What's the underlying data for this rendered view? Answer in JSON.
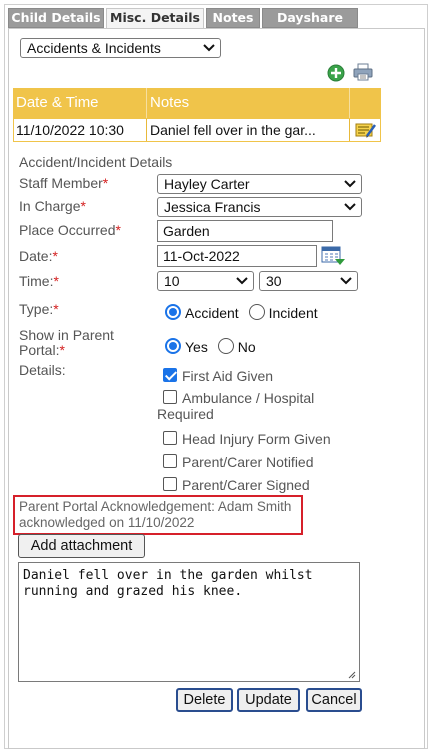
{
  "tabs": [
    {
      "label": "Child Details",
      "active": false
    },
    {
      "label": "Misc. Details",
      "active": true
    },
    {
      "label": "Notes",
      "active": false
    },
    {
      "label": "Dayshare",
      "active": false
    }
  ],
  "category_select": {
    "value": "Accidents & Incidents"
  },
  "toolbar": {
    "add_icon": "add-circle-icon",
    "print_icon": "printer-icon"
  },
  "grid": {
    "columns": [
      "Date & Time",
      "Notes"
    ],
    "rows": [
      {
        "date_time": "11/10/2022 10:30",
        "notes": "Daniel fell over in the gar...",
        "action_icon": "edit-note-icon"
      }
    ],
    "header_color": "#f0c44a"
  },
  "form": {
    "section_title": "Accident/Incident Details",
    "staff_member": {
      "label": "Staff Member",
      "required": "*",
      "value": "Hayley Carter"
    },
    "in_charge": {
      "label": "In Charge",
      "required": "*",
      "value": "Jessica Francis"
    },
    "place_occurred": {
      "label": "Place Occurred",
      "required": "*",
      "value": "Garden"
    },
    "date": {
      "label": "Date:",
      "required": "*",
      "value": "11-Oct-2022",
      "picker_icon": "calendar-icon"
    },
    "time": {
      "label": "Time:",
      "required": "*",
      "hour": "10",
      "minute": "30"
    },
    "type": {
      "label": "Type:",
      "required": "*",
      "options": [
        "Accident",
        "Incident"
      ],
      "selected": "Accident"
    },
    "show_in_portal": {
      "label_line1": "Show in Parent",
      "label_line2": "Portal:",
      "required": "*",
      "options": [
        "Yes",
        "No"
      ],
      "selected": "Yes"
    },
    "details": {
      "label": "Details:",
      "checkboxes": [
        {
          "label": "First Aid Given",
          "checked": true
        },
        {
          "label_line1": "Ambulance / Hospital",
          "label_line2": "Required",
          "checked": false
        },
        {
          "label": "Head Injury Form Given",
          "checked": false
        },
        {
          "label": "Parent/Carer Notified",
          "checked": false
        },
        {
          "label": "Parent/Carer Signed",
          "checked": false
        }
      ]
    }
  },
  "acknowledgement": {
    "line1": "Parent Portal Acknowledgement: Adam Smith",
    "line2": "acknowledged on 11/10/2022",
    "highlight_color": "#d6202a"
  },
  "buttons": {
    "add_attachment": "Add attachment",
    "delete": "Delete",
    "update": "Update",
    "cancel": "Cancel"
  },
  "notes_text": "Daniel fell over in the garden whilst\nrunning and grazed his knee."
}
